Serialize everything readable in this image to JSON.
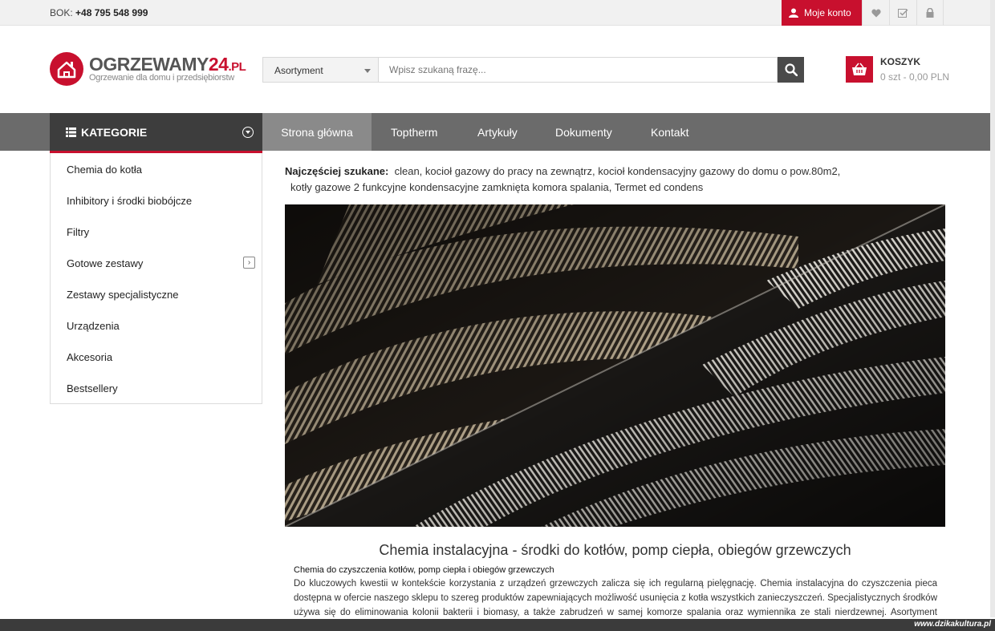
{
  "topbar": {
    "phone_label": "BOK:",
    "phone": "+48 795 548 999",
    "account_label": "Moje konto",
    "icons": [
      "heart-icon",
      "checklist-icon",
      "lock-icon"
    ]
  },
  "header": {
    "logo_main": "OGRZEWAMY",
    "logo_num": "24",
    "logo_tld": ".PL",
    "logo_tagline": "Ogrzewanie dla domu i przedsiębiorstw",
    "search_category": "Asortyment",
    "search_placeholder": "Wpisz szukaną frazę...",
    "cart_title": "KOSZYK",
    "cart_value": "0 szt - 0,00 PLN"
  },
  "nav": {
    "categories_label": "KATEGORIE",
    "items": [
      "Strona główna",
      "Toptherm",
      "Artykuły",
      "Dokumenty",
      "Kontakt"
    ],
    "active": "Strona główna"
  },
  "sidebar": {
    "items": [
      "Chemia do kotła",
      "Inhibitory i środki biobójcze",
      "Filtry",
      "Gotowe zestawy",
      "Zestawy specjalistyczne",
      "Urządzenia",
      "Akcesoria",
      "Bestsellery"
    ]
  },
  "popular": {
    "label": "Najczęściej szukane:",
    "line1": "clean,  kocioł gazowy do pracy na zewnątrz,  kocioł kondensacyjny gazowy do domu o pow.80m2,",
    "line2": "kotły gazowe 2 funkcyjne kondensacyjne zamknięta komora spalania,  Termet ed condens"
  },
  "content": {
    "title": "Chemia instalacyjna - środki do kotłów, pomp ciepła, obiegów grzewczych",
    "subtitle": "Chemia do czyszczenia kotłów, pomp ciepła i obiegów grzewczych",
    "body": "Do kluczowych kwestii w kontekście korzystania z urządzeń grzewczych zalicza się ich regularną pielęgnację. Chemia instalacyjna do czyszczenia pieca dostępna w ofercie naszego sklepu to szereg produktów zapewniających możliwość usunięcia z kotła wszystkich zanieczyszczeń. Specjalistycznych środków używa się do eliminowania kolonii bakterii i biomasy, a także zabrudzeń w samej komorze spalania oraz wymiennika ze stali nierdzewnej. Asortyment obejmuje również filtr magnetyczny, m.in. w wariancie z półautomatycznym systemem pozbywania się tlenków żelaza w układzie"
  },
  "watermark": "www.dzikakultura.pl",
  "colors": {
    "brand_red": "#c8102e",
    "nav_gray": "#6b6b6b",
    "category_dark": "#3d3d3d"
  }
}
